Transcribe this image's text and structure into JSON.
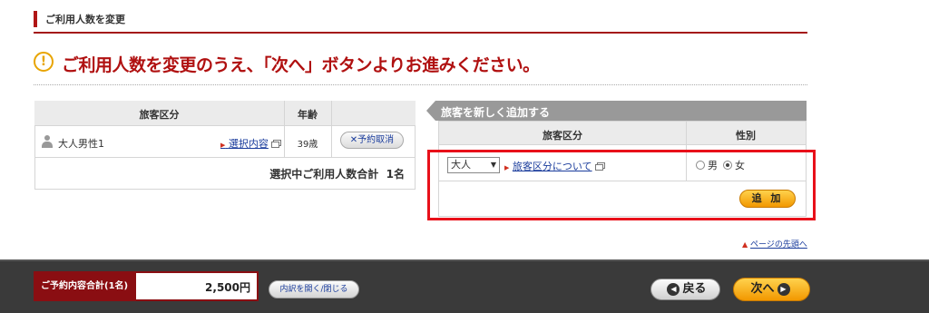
{
  "section": {
    "title": "ご利用人数を変更"
  },
  "notice": {
    "icon": "exclamation-circle-icon",
    "text": "ご利用人数を変更のうえ、「次へ」ボタンよりお進みください。",
    "color": "#b01010"
  },
  "current_table": {
    "headers": {
      "category": "旅客区分",
      "age": "年齢"
    },
    "rows": [
      {
        "name": "大人男性1",
        "detail_link": "選択内容",
        "age": "39歳",
        "cancel_label": "✕予約取消"
      }
    ],
    "total_label": "選択中ご利用人数合計",
    "total_value": "1名"
  },
  "add_panel": {
    "tab_label": "旅客を新しく追加する",
    "headers": {
      "category": "旅客区分",
      "gender": "性別"
    },
    "category_select": {
      "value": "大人"
    },
    "category_link": "旅客区分について",
    "gender_options": [
      {
        "label": "男",
        "checked": false
      },
      {
        "label": "女",
        "checked": true
      }
    ],
    "add_button": "追 加"
  },
  "page_top": {
    "label": "ページの先頭へ"
  },
  "footer": {
    "total_label": "ご予約内容合計(1名)",
    "total_amount": "2,500円",
    "detail_toggle": "内訳を開く/閉じる",
    "back": "戻る",
    "next": "次へ"
  },
  "colors": {
    "accent": "#b01010",
    "highlight": "#e8101a",
    "button_orange": "#f29800",
    "footer_bg": "#3a3a3a"
  }
}
